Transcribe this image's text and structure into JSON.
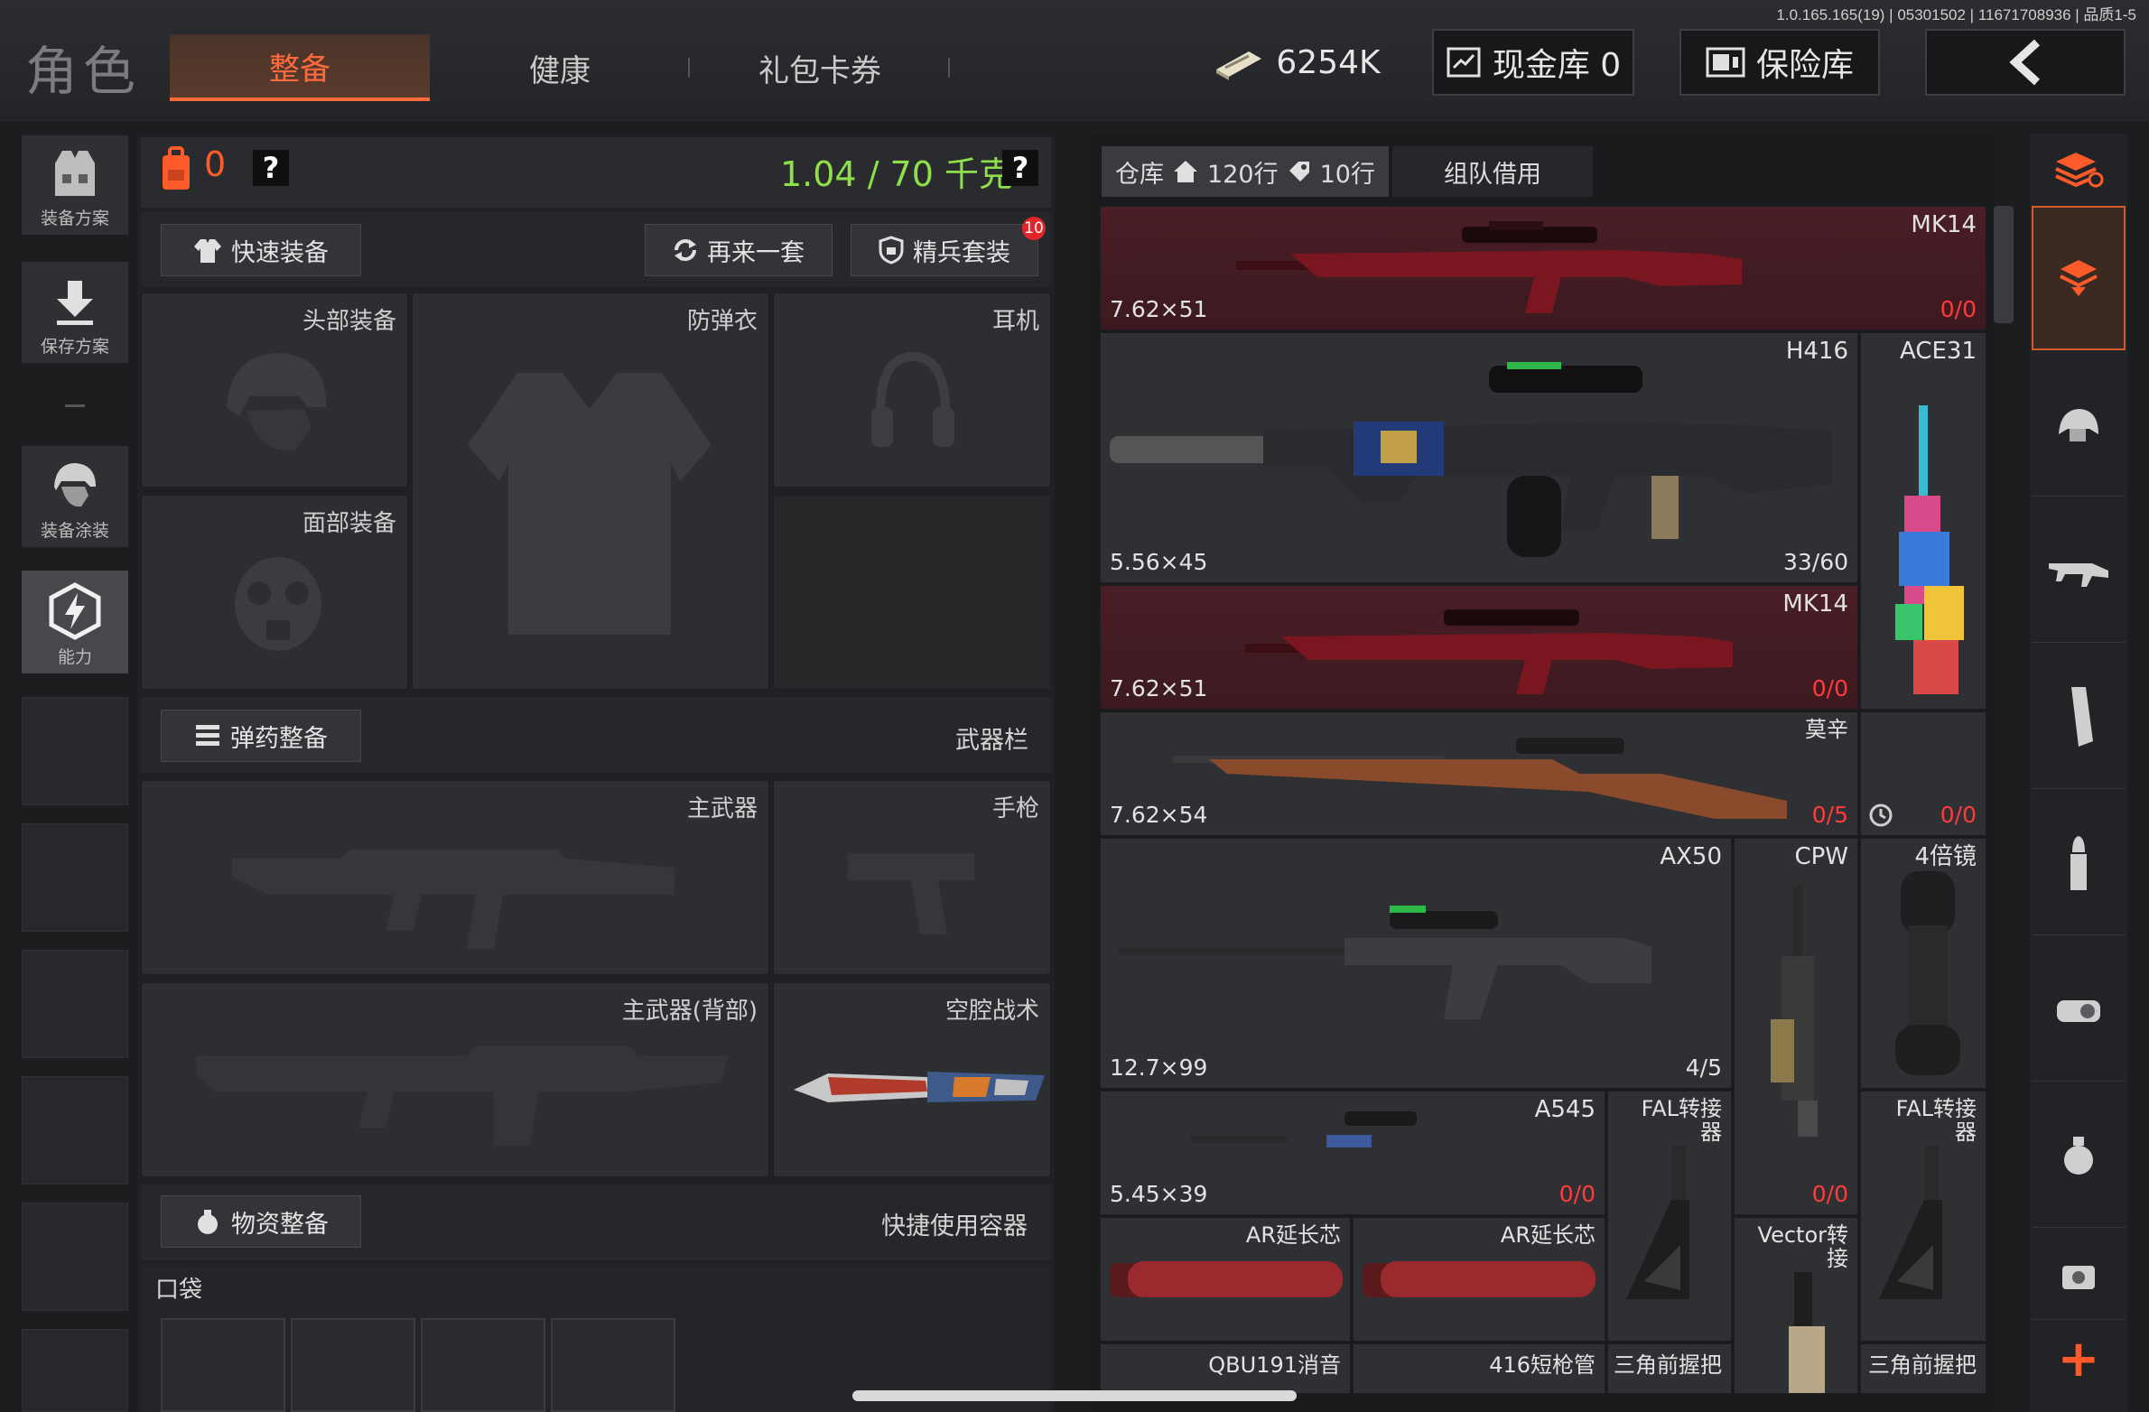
{
  "version_text": "1.0.165.165(19) | 05301502 | 11671708936 | 品质1-5",
  "header": {
    "title": "角色",
    "tabs": [
      {
        "label": "整备",
        "active": true
      },
      {
        "label": "健康",
        "active": false
      },
      {
        "label": "礼包卡券",
        "active": false
      }
    ],
    "money": "6254K",
    "cash_vault": "现金库 0",
    "safe": "保险库",
    "accent_color": "#ff6a3c"
  },
  "sidebar": {
    "items": [
      {
        "label": "装备方案",
        "icon": "vest-icon"
      },
      {
        "label": "保存方案",
        "icon": "download-icon"
      },
      {
        "label": "装备涂装",
        "icon": "helmet-icon"
      },
      {
        "label": "能力",
        "icon": "ability-icon"
      }
    ]
  },
  "loadout": {
    "backpack_count": "0",
    "weight": "1.04 / 70 千克",
    "help": "?",
    "quick_equip": "快速装备",
    "another_set": "再来一套",
    "elite_set": "精兵套装",
    "elite_badge": "10",
    "slots": {
      "head": "头部装备",
      "armor": "防弹衣",
      "headset": "耳机",
      "face": "面部装备"
    },
    "ammo_section": "弹药整备",
    "weapon_bar": "武器栏",
    "primary": "主武器",
    "pistol": "手枪",
    "primary_back": "主武器(背部)",
    "melee": "空腔战术",
    "supplies_section": "物资整备",
    "quick_container": "快捷使用容器",
    "pocket": "口袋"
  },
  "warehouse": {
    "tab_label": "仓库",
    "rows_home": "120行",
    "rows_tag": "10行",
    "team_borrow": "组队借用",
    "items": [
      {
        "name": "MK14",
        "caliber": "7.62×51",
        "count": "0/0"
      },
      {
        "name": "H416",
        "caliber": "5.56×45",
        "count": "33/60"
      },
      {
        "name": "ACE31",
        "caliber": "",
        "count": ""
      },
      {
        "name": "MK14",
        "caliber": "7.62×51",
        "count": "0/0"
      },
      {
        "name": "莫辛",
        "caliber": "7.62×54",
        "count": "0/5"
      },
      {
        "name": "",
        "caliber": "",
        "count": "0/0"
      },
      {
        "name": "AX50",
        "caliber": "12.7×99",
        "count": "4/5"
      },
      {
        "name": "CPW",
        "caliber": "",
        "count": "0/0"
      },
      {
        "name": "4倍镜",
        "caliber": "",
        "count": ""
      },
      {
        "name": "A545",
        "caliber": "5.45×39",
        "count": "0/0"
      },
      {
        "name": "FAL转接器",
        "caliber": "",
        "count": ""
      },
      {
        "name": "FAL转接器",
        "caliber": "",
        "count": ""
      },
      {
        "name": "AR延长芯",
        "caliber": "",
        "count": ""
      },
      {
        "name": "AR延长芯",
        "caliber": "",
        "count": ""
      },
      {
        "name": "Vector转接",
        "caliber": "",
        "count": ""
      },
      {
        "name": "QBU191消音",
        "caliber": "",
        "count": ""
      },
      {
        "name": "416短枪管",
        "caliber": "",
        "count": ""
      },
      {
        "name": "三角前握把",
        "caliber": "",
        "count": ""
      },
      {
        "name": "三角前握把",
        "caliber": "",
        "count": ""
      }
    ]
  },
  "categories": [
    "all-icon",
    "hat-icon",
    "helmet-icon",
    "rifle-icon",
    "magazine-icon",
    "bullet-icon",
    "sight-icon",
    "grenade-icon",
    "misc-icon"
  ],
  "add_label": "+"
}
